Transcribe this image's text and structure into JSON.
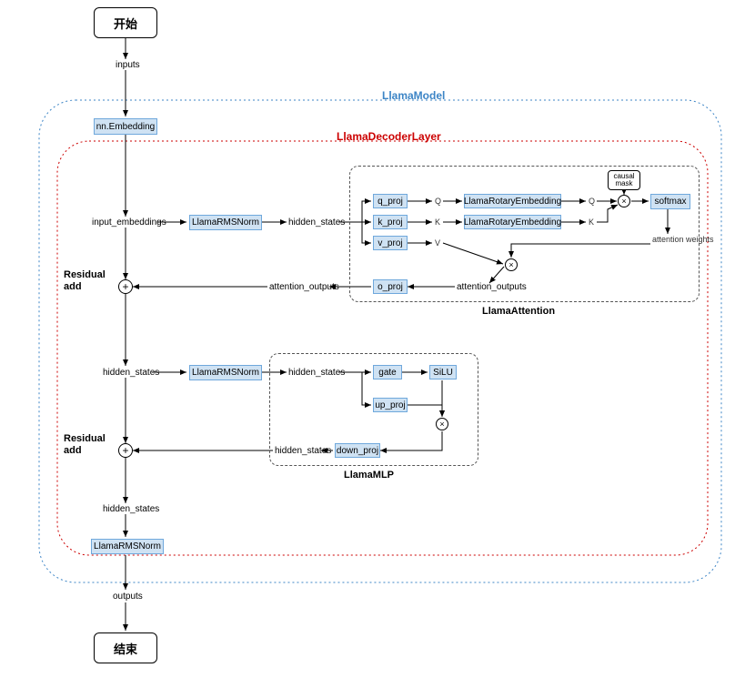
{
  "title_model": "LlamaModel",
  "title_decoder": "LlamaDecoderLayer",
  "title_attention": "LlamaAttention",
  "title_mlp": "LlamaMLP",
  "start": "开始",
  "end": "结束",
  "inputs": "inputs",
  "outputs": "outputs",
  "embedding": "nn.Embedding",
  "input_embeddings": "input_embeddings",
  "rmsnorm": "LlamaRMSNorm",
  "hidden_states": "hidden_states",
  "q_proj": "q_proj",
  "k_proj": "k_proj",
  "v_proj": "v_proj",
  "o_proj": "o_proj",
  "Q": "Q",
  "K": "K",
  "V": "V",
  "rotary": "LlamaRotaryEmbedding",
  "causal_mask": "causal mask",
  "softmax": "softmax",
  "attention_weights": "attention weights",
  "attention_outputs": "attention_outputs",
  "residual_add": "Residual add",
  "gate": "gate",
  "silu": "SiLU",
  "up_proj": "up_proj",
  "down_proj": "down_proj"
}
